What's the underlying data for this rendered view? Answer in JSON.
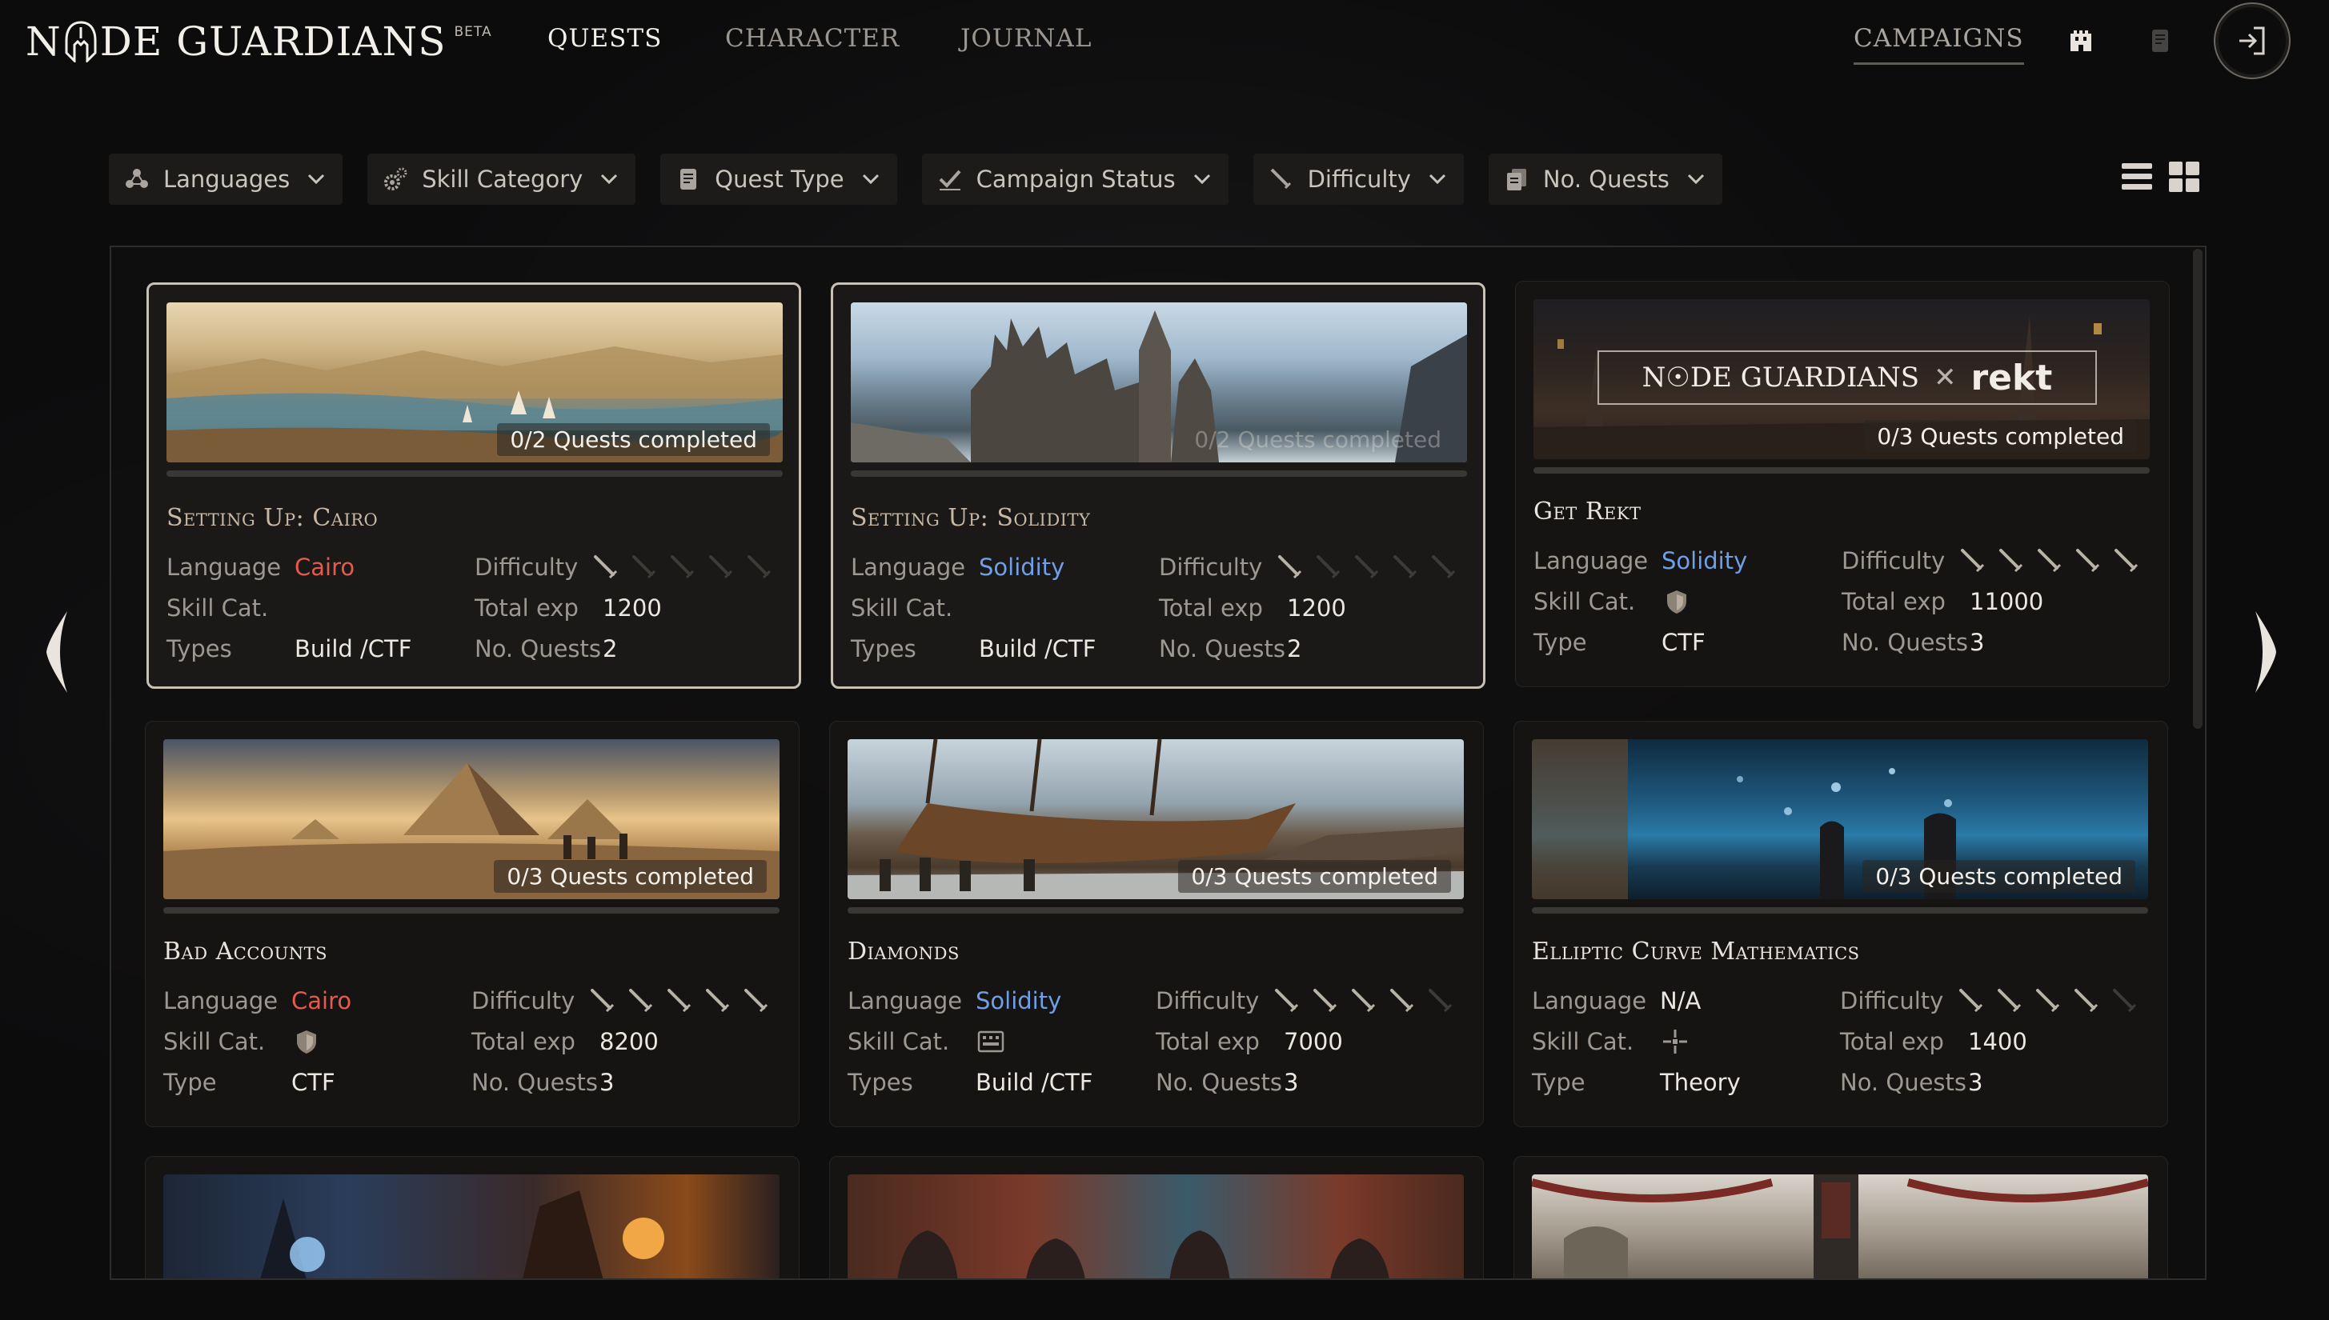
{
  "header": {
    "logo_text": "N☉DE GUARDIANS",
    "logo_part1": "N",
    "logo_part2": "DE GUARDIANS",
    "beta": "BETA",
    "nav": {
      "quests": "Quests",
      "character": "Character",
      "journal": "Journal",
      "campaigns": "Campaigns"
    }
  },
  "filters": [
    {
      "label": "Languages",
      "icon": "nodes-icon"
    },
    {
      "label": "Skill Category",
      "icon": "gears-icon"
    },
    {
      "label": "Quest Type",
      "icon": "scroll-icon"
    },
    {
      "label": "Campaign Status",
      "icon": "check-icon"
    },
    {
      "label": "Difficulty",
      "icon": "sword-icon"
    },
    {
      "label": "No. Quests",
      "icon": "stack-icon"
    }
  ],
  "labels": {
    "language": "Language",
    "skill_cat": "Skill Cat.",
    "types": "Types",
    "type": "Type",
    "difficulty": "Difficulty",
    "total_exp": "Total exp",
    "no_quests": "No. Quests"
  },
  "campaigns": [
    {
      "title": "Setting Up: Cairo",
      "progress": "0/2 Quests completed",
      "language": "Cairo",
      "language_color": "#e45a4c",
      "skill_icon": "",
      "type_label": "Types",
      "type": "Build /CTF",
      "difficulty": 1,
      "total_exp": "1200",
      "no_quests": "2",
      "selected": true
    },
    {
      "title": "Setting Up: Solidity",
      "progress": "0/2 Quests completed",
      "language": "Solidity",
      "language_color": "#6f9fe6",
      "skill_icon": "",
      "type_label": "Types",
      "type": "Build /CTF",
      "difficulty": 1,
      "total_exp": "1200",
      "no_quests": "2",
      "selected": true
    },
    {
      "title": "Get Rekt",
      "progress": "0/3 Quests completed",
      "language": "Solidity",
      "language_color": "#6f9fe6",
      "skill_icon": "shield-icon",
      "type_label": "Type",
      "type": "CTF",
      "difficulty": 5,
      "total_exp": "11000",
      "no_quests": "3",
      "selected": false,
      "banner": {
        "left": "N☉DE GUARDIANS",
        "x": "✕",
        "right": "rekt"
      }
    },
    {
      "title": "Bad Accounts",
      "progress": "0/3 Quests completed",
      "language": "Cairo",
      "language_color": "#e45a4c",
      "skill_icon": "shield-icon",
      "type_label": "Type",
      "type": "CTF",
      "difficulty": 5,
      "total_exp": "8200",
      "no_quests": "3",
      "selected": false
    },
    {
      "title": "Diamonds",
      "progress": "0/3 Quests completed",
      "language": "Solidity",
      "language_color": "#6f9fe6",
      "skill_icon": "keyboard-icon",
      "type_label": "Types",
      "type": "Build /CTF",
      "difficulty": 4,
      "total_exp": "7000",
      "no_quests": "3",
      "selected": false
    },
    {
      "title": "Elliptic Curve Mathematics",
      "progress": "0/3 Quests completed",
      "language": "N/A",
      "language_color": "#ece8e1",
      "skill_icon": "crosshair-icon",
      "type_label": "Type",
      "type": "Theory",
      "difficulty": 4,
      "total_exp": "1400",
      "no_quests": "3",
      "selected": false
    }
  ],
  "colors": {
    "accent": "#c9c1b4",
    "cairo": "#e45a4c",
    "solidity": "#6f9fe6",
    "background": "#0c0c0d"
  }
}
